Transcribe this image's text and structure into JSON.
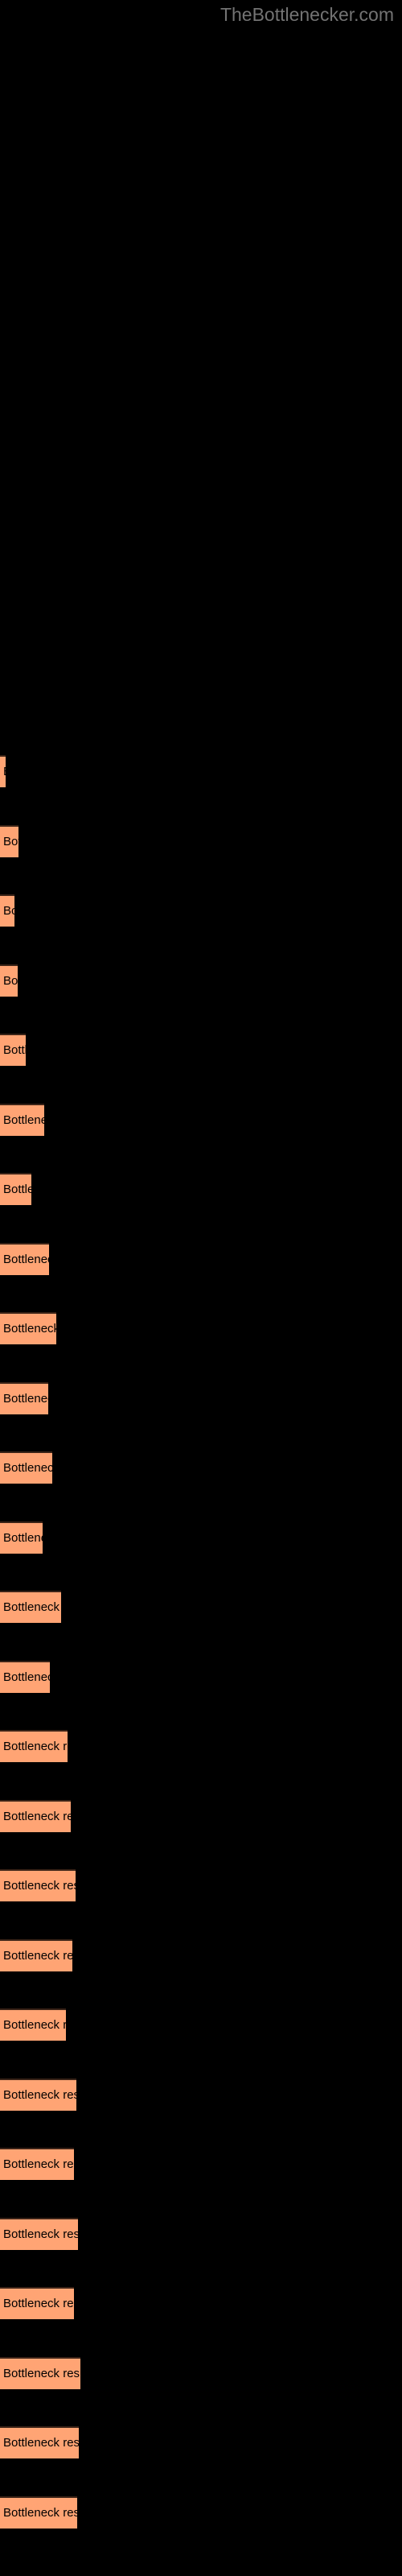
{
  "site": {
    "title": "TheBottlenecker.com",
    "title_color": "#737373"
  },
  "colors": {
    "background": "#000000",
    "bar_fill": "#ffa474",
    "bar_border": "#3a2317",
    "bar_label": "#000000"
  },
  "chart_data": {
    "type": "bar",
    "orientation": "horizontal",
    "title": "TheBottlenecker.com",
    "xlabel": "",
    "ylabel": "",
    "grid": false,
    "legend": false,
    "bar_label_text": "Bottleneck result",
    "xlim": [
      0,
      96
    ],
    "categories": [
      "Bottleneck result",
      "Bottleneck result",
      "Bottleneck result",
      "Bottleneck result",
      "Bottleneck result",
      "Bottleneck result",
      "Bottleneck result",
      "Bottleneck result",
      "Bottleneck result",
      "Bottleneck result",
      "Bottleneck result",
      "Bottleneck result",
      "Bottleneck result",
      "Bottleneck result",
      "Bottleneck result",
      "Bottleneck result",
      "Bottleneck result",
      "Bottleneck result",
      "Bottleneck result",
      "Bottleneck result",
      "Bottleneck result",
      "Bottleneck result",
      "Bottleneck result",
      "Bottleneck result",
      "Bottleneck result",
      "Bottleneck result"
    ],
    "values": [
      7,
      23,
      18,
      22,
      32,
      55,
      39,
      61,
      70,
      60,
      65,
      53,
      76,
      62,
      84,
      88,
      94,
      90,
      82,
      95,
      92,
      97,
      92,
      100,
      98,
      96
    ]
  },
  "bars": [
    {
      "label": "Bottleneck result",
      "top": 938,
      "width": 7
    },
    {
      "label": "Bottleneck result",
      "top": 1025,
      "width": 23
    },
    {
      "label": "Bottleneck result",
      "top": 1111,
      "width": 18
    },
    {
      "label": "Bottleneck result",
      "top": 1198,
      "width": 22
    },
    {
      "label": "Bottleneck result",
      "top": 1284,
      "width": 32
    },
    {
      "label": "Bottleneck result",
      "top": 1371,
      "width": 55
    },
    {
      "label": "Bottleneck result",
      "top": 1457,
      "width": 39
    },
    {
      "label": "Bottleneck result",
      "top": 1544,
      "width": 61
    },
    {
      "label": "Bottleneck result",
      "top": 1630,
      "width": 70
    },
    {
      "label": "Bottleneck result",
      "top": 1717,
      "width": 60
    },
    {
      "label": "Bottleneck result",
      "top": 1803,
      "width": 65
    },
    {
      "label": "Bottleneck result",
      "top": 1890,
      "width": 53
    },
    {
      "label": "Bottleneck result",
      "top": 1976,
      "width": 76
    },
    {
      "label": "Bottleneck result",
      "top": 2063,
      "width": 62
    },
    {
      "label": "Bottleneck result",
      "top": 2149,
      "width": 84
    },
    {
      "label": "Bottleneck result",
      "top": 2236,
      "width": 88
    },
    {
      "label": "Bottleneck result",
      "top": 2322,
      "width": 94
    },
    {
      "label": "Bottleneck result",
      "top": 2409,
      "width": 90
    },
    {
      "label": "Bottleneck result",
      "top": 2495,
      "width": 82
    },
    {
      "label": "Bottleneck result",
      "top": 2582,
      "width": 95
    },
    {
      "label": "Bottleneck result",
      "top": 2668,
      "width": 92
    },
    {
      "label": "Bottleneck result",
      "top": 2755,
      "width": 97
    },
    {
      "label": "Bottleneck result",
      "top": 2841,
      "width": 92
    },
    {
      "label": "Bottleneck result",
      "top": 2928,
      "width": 100
    },
    {
      "label": "Bottleneck result",
      "top": 3014,
      "width": 98
    },
    {
      "label": "Bottleneck result",
      "top": 3101,
      "width": 96
    }
  ]
}
